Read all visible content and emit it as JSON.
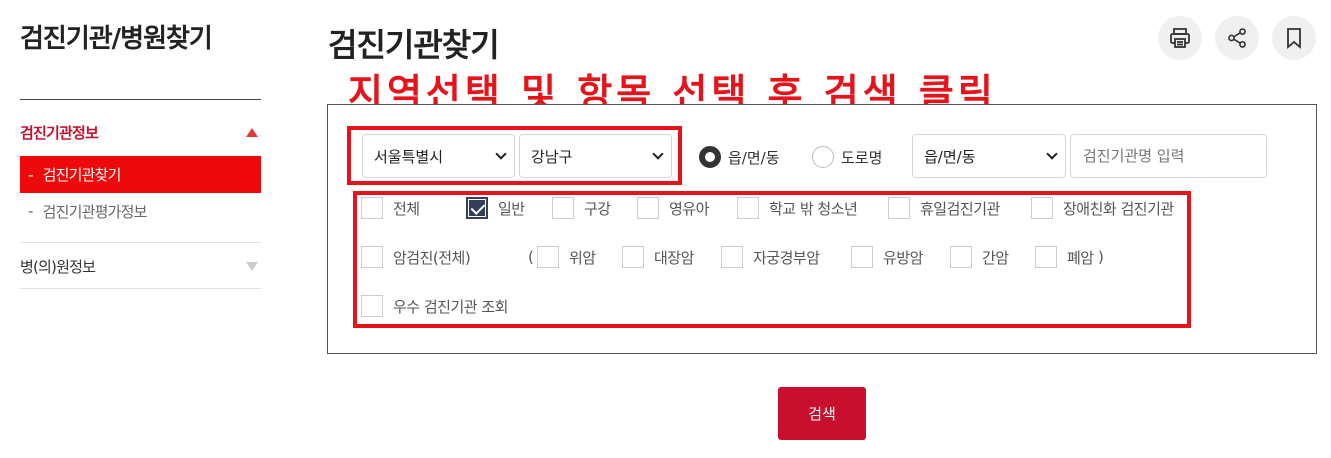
{
  "sidebar": {
    "title": "검진기관/병원찾기",
    "sections": [
      {
        "label": "검진기관정보",
        "items": [
          {
            "label": "검진기관찾기",
            "active": true
          },
          {
            "label": "검진기관평가정보",
            "active": false
          }
        ]
      },
      {
        "label": "병(의)원정보",
        "items": []
      }
    ]
  },
  "main": {
    "title": "검진기관찾기",
    "annotation": "지역선택 및 항목 선택 후 검색 클릭",
    "toolbar": [
      "print-icon",
      "share-icon",
      "bookmark-icon"
    ],
    "filters": {
      "region_city": "서울특별시",
      "region_district": "강남구",
      "address_type_options": [
        {
          "label": "읍/면/동",
          "selected": true
        },
        {
          "label": "도로명",
          "selected": false
        }
      ],
      "dong_select": "읍/면/동",
      "name_placeholder": "검진기관명 입력"
    },
    "checkboxes_row1": [
      {
        "label": "전체",
        "checked": false
      },
      {
        "label": "일반",
        "checked": true
      },
      {
        "label": "구강",
        "checked": false
      },
      {
        "label": "영유아",
        "checked": false
      },
      {
        "label": "학교 밖 청소년",
        "checked": false
      },
      {
        "label": "휴일검진기관",
        "checked": false
      },
      {
        "label": "장애친화 검진기관",
        "checked": false
      }
    ],
    "checkboxes_row2": [
      {
        "label": "암검진(전체)",
        "checked": false
      },
      {
        "label": "위암",
        "checked": false
      },
      {
        "label": "대장암",
        "checked": false
      },
      {
        "label": "자궁경부암",
        "checked": false
      },
      {
        "label": "유방암",
        "checked": false
      },
      {
        "label": "간암",
        "checked": false
      },
      {
        "label": "폐암",
        "checked": false
      }
    ],
    "paren_open": "(",
    "paren_close": ")",
    "checkboxes_row3": [
      {
        "label": "우수 검진기관 조회",
        "checked": false
      }
    ],
    "search_label": "검색"
  },
  "colors": {
    "accent": "#c8102e",
    "annotation_red": "#e5141b",
    "sidebar_active": "#ee0a0a",
    "checkbox_checked": "#333f5a"
  }
}
